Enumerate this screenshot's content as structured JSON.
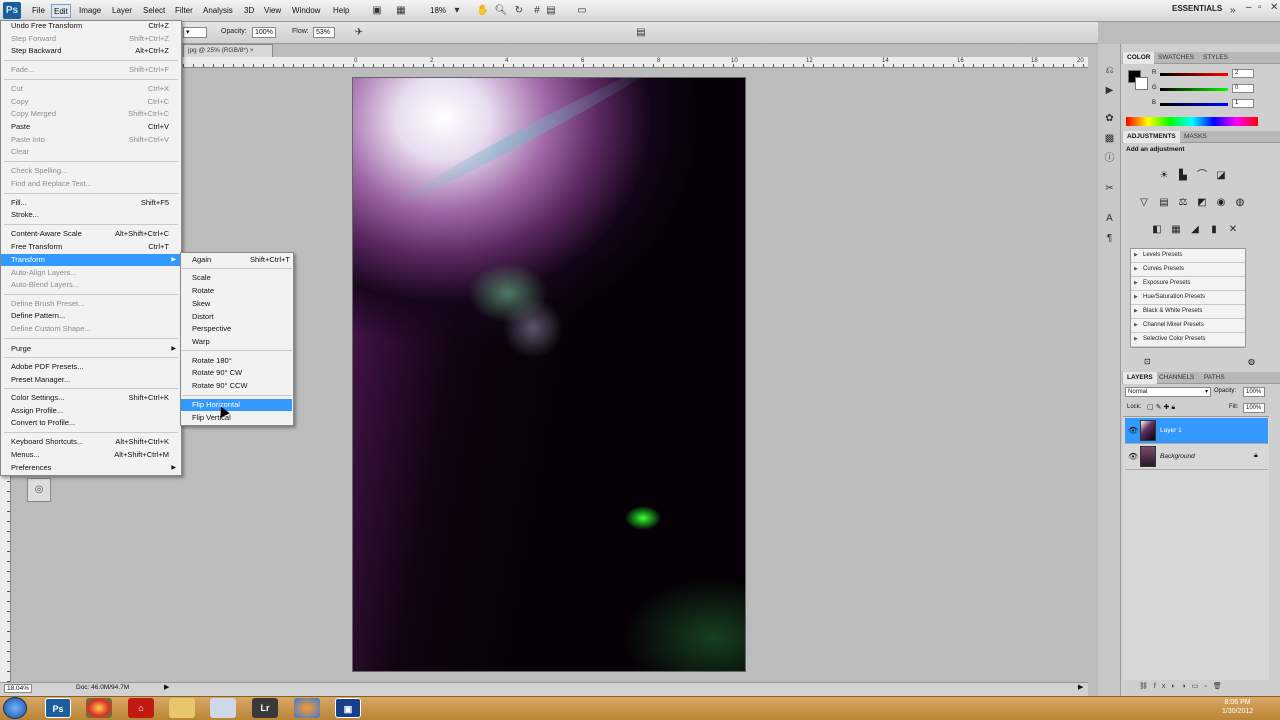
{
  "menubar": {
    "logo": "Ps",
    "items": [
      "File",
      "Edit",
      "Image",
      "Layer",
      "Select",
      "Filter",
      "Analysis",
      "3D",
      "View",
      "Window",
      "Help"
    ],
    "zoom": "18%",
    "workspace": "ESSENTIALS"
  },
  "options": {
    "opacity_label": "Opacity:",
    "opacity_value": "100%",
    "flow_label": "Flow:",
    "flow_value": "53%"
  },
  "document": {
    "tab_title": "jpg @ 25% (RGB/8*)",
    "zoom_readout": "18.04%",
    "doc_size": "Doc: 46.0M/94.7M"
  },
  "ruler_numbers": [
    "0",
    "2",
    "4",
    "6",
    "8",
    "10",
    "12",
    "14",
    "16",
    "18",
    "20"
  ],
  "edit_menu": {
    "items": [
      {
        "label": "Undo Free Transform",
        "shortcut": "Ctrl+Z",
        "disabled": false
      },
      {
        "label": "Step Forward",
        "shortcut": "Shift+Ctrl+Z",
        "disabled": true
      },
      {
        "label": "Step Backward",
        "shortcut": "Alt+Ctrl+Z",
        "disabled": false
      },
      {
        "label": "Fade...",
        "shortcut": "Shift+Ctrl+F",
        "disabled": true
      },
      {
        "label": "Cut",
        "shortcut": "Ctrl+X",
        "disabled": true
      },
      {
        "label": "Copy",
        "shortcut": "Ctrl+C",
        "disabled": true
      },
      {
        "label": "Copy Merged",
        "shortcut": "Shift+Ctrl+C",
        "disabled": true
      },
      {
        "label": "Paste",
        "shortcut": "Ctrl+V",
        "disabled": false
      },
      {
        "label": "Paste Into",
        "shortcut": "Shift+Ctrl+V",
        "disabled": true
      },
      {
        "label": "Clear",
        "shortcut": "",
        "disabled": true
      },
      {
        "label": "Check Spelling...",
        "shortcut": "",
        "disabled": true
      },
      {
        "label": "Find and Replace Text...",
        "shortcut": "",
        "disabled": true
      },
      {
        "label": "Fill...",
        "shortcut": "Shift+F5",
        "disabled": false
      },
      {
        "label": "Stroke...",
        "shortcut": "",
        "disabled": false
      },
      {
        "label": "Content-Aware Scale",
        "shortcut": "Alt+Shift+Ctrl+C",
        "disabled": false
      },
      {
        "label": "Free Transform",
        "shortcut": "Ctrl+T",
        "disabled": false
      },
      {
        "label": "Transform",
        "shortcut": "",
        "disabled": false
      },
      {
        "label": "Auto-Align Layers...",
        "shortcut": "",
        "disabled": true
      },
      {
        "label": "Auto-Blend Layers...",
        "shortcut": "",
        "disabled": true
      },
      {
        "label": "Define Brush Preset...",
        "shortcut": "",
        "disabled": true
      },
      {
        "label": "Define Pattern...",
        "shortcut": "",
        "disabled": false
      },
      {
        "label": "Define Custom Shape...",
        "shortcut": "",
        "disabled": true
      },
      {
        "label": "Purge",
        "shortcut": "",
        "disabled": false
      },
      {
        "label": "Adobe PDF Presets...",
        "shortcut": "",
        "disabled": false
      },
      {
        "label": "Preset Manager...",
        "shortcut": "",
        "disabled": false
      },
      {
        "label": "Color Settings...",
        "shortcut": "Shift+Ctrl+K",
        "disabled": false
      },
      {
        "label": "Assign Profile...",
        "shortcut": "",
        "disabled": false
      },
      {
        "label": "Convert to Profile...",
        "shortcut": "",
        "disabled": false
      },
      {
        "label": "Keyboard Shortcuts...",
        "shortcut": "Alt+Shift+Ctrl+K",
        "disabled": false
      },
      {
        "label": "Menus...",
        "shortcut": "Alt+Shift+Ctrl+M",
        "disabled": false
      },
      {
        "label": "Preferences",
        "shortcut": "",
        "disabled": false
      }
    ]
  },
  "transform_menu": {
    "again": "Again",
    "again_shortcut": "Shift+Ctrl+T",
    "items": [
      "Scale",
      "Rotate",
      "Skew",
      "Distort",
      "Perspective",
      "Warp",
      "Rotate 180°",
      "Rotate 90° CW",
      "Rotate 90° CCW",
      "Flip Horizontal",
      "Flip Vertical"
    ]
  },
  "color_panel": {
    "tabs": [
      "COLOR",
      "SWATCHES",
      "STYLES"
    ],
    "r": "2",
    "g": "0",
    "b": "1",
    "labels": [
      "R",
      "G",
      "B"
    ]
  },
  "adjustments_panel": {
    "tabs": [
      "ADJUSTMENTS",
      "MASKS"
    ],
    "heading": "Add an adjustment",
    "presets": [
      "Levels Presets",
      "Curves Presets",
      "Exposure Presets",
      "Hue/Saturation Presets",
      "Black & White Presets",
      "Channel Mixer Presets",
      "Selective Color Presets"
    ]
  },
  "layers_panel": {
    "tabs": [
      "LAYERS",
      "CHANNELS",
      "PATHS"
    ],
    "blend_mode": "Normal",
    "opacity_label": "Opacity:",
    "opacity": "100%",
    "lock_label": "Lock:",
    "fill_label": "Fill:",
    "fill": "100%",
    "layers": [
      "Layer 1",
      "Background"
    ]
  },
  "taskbar": {
    "time": "8:06 PM",
    "date": "1/30/2012",
    "apps": [
      "Ps",
      "Lr"
    ]
  },
  "colors": {
    "selection": "#3399ff",
    "ps_blue": "#1b5e9e"
  }
}
